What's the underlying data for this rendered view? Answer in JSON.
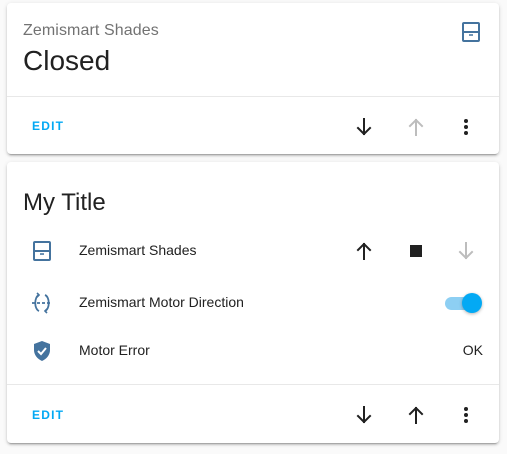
{
  "colors": {
    "accent": "#03a9f4",
    "entity_icon": "#44739e",
    "disabled_icon": "#bdbdbd",
    "text_primary": "#212121",
    "text_secondary": "#727272"
  },
  "card1": {
    "entity_name": "Zemismart Shades",
    "state": "Closed",
    "icon": "window-shutter-icon",
    "edit_label": "EDIT",
    "actions": [
      {
        "icon": "arrow-down-icon",
        "enabled": true
      },
      {
        "icon": "arrow-up-icon",
        "enabled": false
      },
      {
        "icon": "more-vertical-icon",
        "enabled": true
      }
    ]
  },
  "card2": {
    "title": "My Title",
    "rows": [
      {
        "icon": "window-shutter-icon",
        "label": "Zemismart Shades",
        "controls": [
          "arrow-up-icon",
          "stop-icon",
          "arrow-down-icon"
        ],
        "arrow_down_enabled": false
      },
      {
        "icon": "swap-direction-icon",
        "label": "Zemismart Motor Direction",
        "toggle_on": true
      },
      {
        "icon": "shield-check-icon",
        "label": "Motor Error",
        "value": "OK"
      }
    ],
    "edit_label": "EDIT",
    "actions": [
      {
        "icon": "arrow-down-icon",
        "enabled": true
      },
      {
        "icon": "arrow-up-icon",
        "enabled": true
      },
      {
        "icon": "more-vertical-icon",
        "enabled": true
      }
    ]
  }
}
